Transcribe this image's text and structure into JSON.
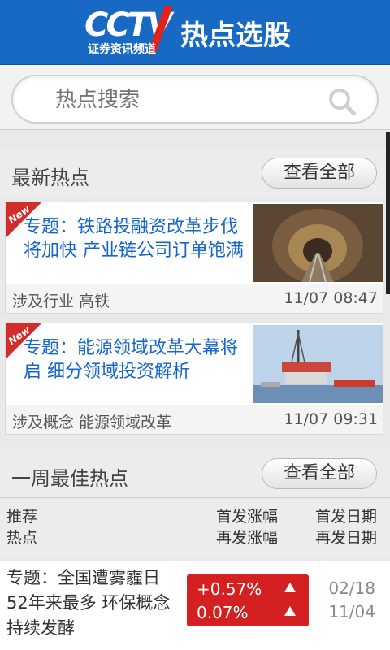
{
  "header": {
    "logo_text": "CCTV",
    "logo_sub": "证券资讯频道",
    "title": "热点选股"
  },
  "search": {
    "placeholder": "热点搜索",
    "icon": "search-icon"
  },
  "latest": {
    "heading": "最新热点",
    "view_all": "查看全部",
    "items": [
      {
        "badge": "New",
        "title": "专题：铁路投融资改革步伐将加快 产业链公司订单饱满",
        "tag": "涉及行业 高铁",
        "time": "11/07 08:47",
        "image": "railway-tunnel"
      },
      {
        "badge": "New",
        "title": "专题：能源领域改革大幕将启 细分领域投资解析",
        "tag": "涉及概念 能源领域改革",
        "time": "11/07 09:31",
        "image": "offshore-oil-platform"
      }
    ]
  },
  "weekly": {
    "heading": "一周最佳热点",
    "view_all": "查看全部",
    "columns": {
      "col1_line1": "推荐",
      "col1_line2": "热点",
      "col2_line1": "首发涨幅",
      "col2_line2": "再发涨幅",
      "col3_line1": "首发日期",
      "col3_line2": "再发日期"
    },
    "rows": [
      {
        "title": "专题：全国遭雾霾日52年来最多 环保概念持续发酵",
        "first_change": "+0.57%",
        "second_change": "0.07%",
        "first_date": "02/18",
        "second_date": "11/04",
        "color": "#d42020"
      }
    ]
  }
}
